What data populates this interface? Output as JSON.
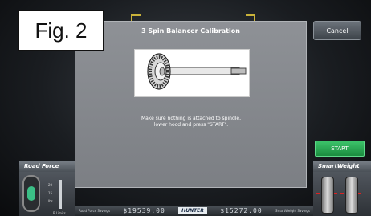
{
  "figure": {
    "label": "Fig. 2"
  },
  "dialog": {
    "title": "3 Spin Balancer Calibration",
    "instruction_line1": "Make sure nothing is attached to spindle,",
    "instruction_line2": "lower hood and press \"START\"."
  },
  "buttons": {
    "cancel": "Cancel",
    "start": "START"
  },
  "left_panel": {
    "title": "Road Force",
    "scale_ticks": [
      "20",
      "15",
      "lbs"
    ],
    "limits_label": "P Limits"
  },
  "right_panel": {
    "title": "SmartWeight"
  },
  "bottom_bar": {
    "left_label": "Road Force Savings",
    "left_counter": "$19539.00",
    "brand": "HUNTER",
    "right_counter": "$15272.00",
    "right_label": "SmartWeight Savings"
  },
  "colors": {
    "start_green": "#2aa655",
    "tire_accent": "#3bbf86",
    "top_bracket": "#c9b23a"
  }
}
